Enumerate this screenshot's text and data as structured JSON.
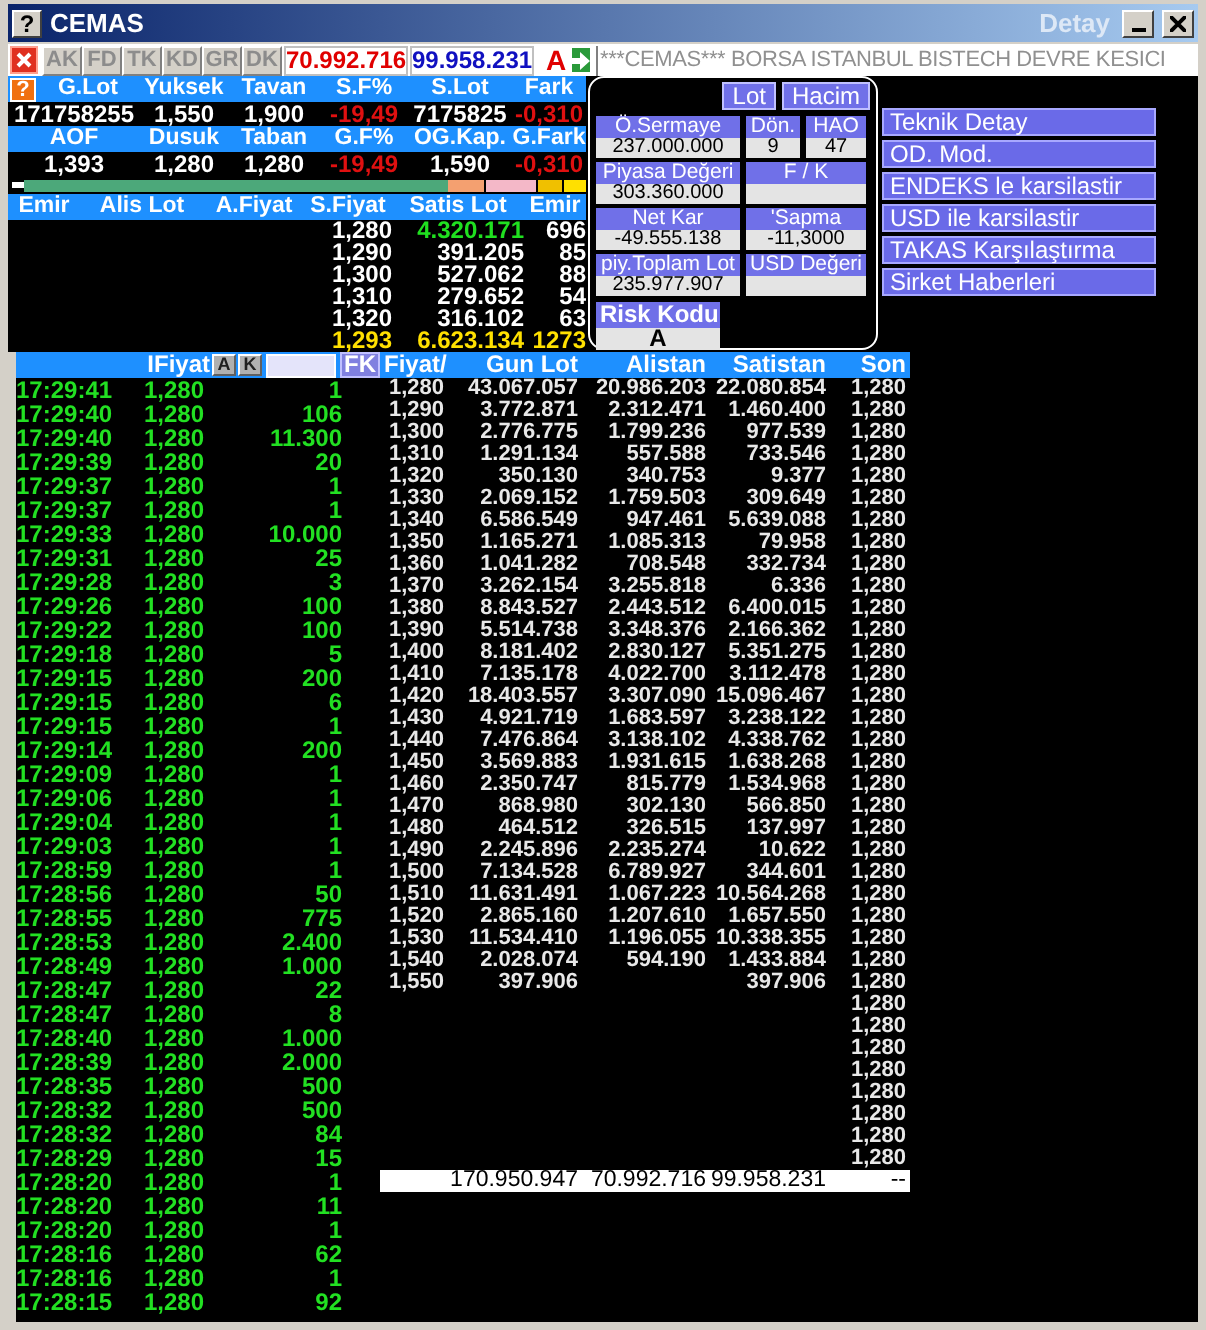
{
  "window": {
    "help_glyph": "?",
    "title": "CEMAS",
    "subtitle": "Detay"
  },
  "toolbar": {
    "buttons": [
      "AK",
      "FD",
      "TK",
      "KD",
      "GR",
      "DK"
    ],
    "values": [
      {
        "text": "70.992.716",
        "color": "#e00000"
      },
      {
        "text": "99.958.231",
        "color": "#1010c0"
      }
    ],
    "flag": "A",
    "ticker": "***CEMAS*** BORSA ISTANBUL BISTECH DEVRE KESICI"
  },
  "quote": {
    "rows": [
      {
        "help": "?",
        "headers": [
          "G.Lot",
          "Yuksek",
          "Tavan",
          "S.F%",
          "S.Lot",
          "Fark"
        ],
        "values": [
          {
            "text": "171758255",
            "negative": false
          },
          {
            "text": "1,550",
            "negative": false
          },
          {
            "text": "1,900",
            "negative": false
          },
          {
            "text": "-19,49",
            "negative": true
          },
          {
            "text": "7175825",
            "negative": false
          },
          {
            "text": "-0,310",
            "negative": true
          }
        ]
      },
      {
        "headers": [
          "AOF",
          "Dusuk",
          "Taban",
          "G.F%",
          "OG.Kap.",
          "G.Fark"
        ],
        "values": [
          {
            "text": "1,393",
            "negative": false
          },
          {
            "text": "1,280",
            "negative": false
          },
          {
            "text": "1,280",
            "negative": false
          },
          {
            "text": "-19,49",
            "negative": true
          },
          {
            "text": "1,590",
            "negative": false
          },
          {
            "text": "-0,310",
            "negative": true
          }
        ]
      }
    ]
  },
  "order_book": {
    "columns": [
      "Emir",
      "Alis Lot",
      "A.Fiyat",
      "S.Fiyat",
      "Satis Lot",
      "Emir"
    ],
    "rows": [
      {
        "s_fiyat": "1,280",
        "satis_lot": "4.320.171",
        "emir": "696",
        "highlight": true
      },
      {
        "s_fiyat": "1,290",
        "satis_lot": "391.205",
        "emir": "85",
        "highlight": false
      },
      {
        "s_fiyat": "1,300",
        "satis_lot": "527.062",
        "emir": "88",
        "highlight": false
      },
      {
        "s_fiyat": "1,310",
        "satis_lot": "279.652",
        "emir": "54",
        "highlight": false
      },
      {
        "s_fiyat": "1,320",
        "satis_lot": "316.102",
        "emir": "63",
        "highlight": false
      }
    ],
    "total": {
      "s_fiyat": "1,293",
      "satis_lot": "6.623.134",
      "emir": "1273"
    }
  },
  "info_panel": {
    "toggles": [
      "Lot",
      "Hacim"
    ],
    "rows": [
      {
        "fields": [
          {
            "label": "Ö.Sermaye",
            "value": "237.000.000"
          },
          {
            "label": "Dön.",
            "value": "9"
          },
          {
            "label": "HAO",
            "value": "47"
          }
        ]
      },
      {
        "fields": [
          {
            "label": "Piyasa Değeri",
            "value": "303.360.000"
          },
          {
            "label": "F / K"
          }
        ]
      },
      {
        "fields": [
          {
            "label": "Net Kar",
            "value": "-49.555.138"
          },
          {
            "label": "'Sapma",
            "value": "-11,3000"
          }
        ]
      },
      {
        "fields": [
          {
            "label": "piy.Toplam Lot",
            "value": "235.977.907"
          },
          {
            "label": "USD Değeri"
          }
        ]
      }
    ],
    "risk": {
      "label": "Risk Kodu",
      "value": "A"
    }
  },
  "menu": [
    "Teknik Detay",
    "OD. Mod.",
    "ENDEKS le karsilastir",
    "USD ile karsilastir",
    "TAKAS Karşılaştırma",
    "Sirket Haberleri"
  ],
  "trades": {
    "header": {
      "label": "IFiyat",
      "buttons": [
        "A",
        "K"
      ],
      "filter_button": "FK"
    },
    "rows": [
      [
        "17:29:41",
        "1,280",
        "1"
      ],
      [
        "17:29:40",
        "1,280",
        "106"
      ],
      [
        "17:29:40",
        "1,280",
        "11.300"
      ],
      [
        "17:29:39",
        "1,280",
        "20"
      ],
      [
        "17:29:37",
        "1,280",
        "1"
      ],
      [
        "17:29:37",
        "1,280",
        "1"
      ],
      [
        "17:29:33",
        "1,280",
        "10.000"
      ],
      [
        "17:29:31",
        "1,280",
        "25"
      ],
      [
        "17:29:28",
        "1,280",
        "3"
      ],
      [
        "17:29:26",
        "1,280",
        "100"
      ],
      [
        "17:29:22",
        "1,280",
        "100"
      ],
      [
        "17:29:18",
        "1,280",
        "5"
      ],
      [
        "17:29:15",
        "1,280",
        "200"
      ],
      [
        "17:29:15",
        "1,280",
        "6"
      ],
      [
        "17:29:15",
        "1,280",
        "1"
      ],
      [
        "17:29:14",
        "1,280",
        "200"
      ],
      [
        "17:29:09",
        "1,280",
        "1"
      ],
      [
        "17:29:06",
        "1,280",
        "1"
      ],
      [
        "17:29:04",
        "1,280",
        "1"
      ],
      [
        "17:29:03",
        "1,280",
        "1"
      ],
      [
        "17:28:59",
        "1,280",
        "1"
      ],
      [
        "17:28:56",
        "1,280",
        "50"
      ],
      [
        "17:28:55",
        "1,280",
        "775"
      ],
      [
        "17:28:53",
        "1,280",
        "2.400"
      ],
      [
        "17:28:49",
        "1,280",
        "1.000"
      ],
      [
        "17:28:47",
        "1,280",
        "22"
      ],
      [
        "17:28:47",
        "1,280",
        "8"
      ],
      [
        "17:28:40",
        "1,280",
        "1.000"
      ],
      [
        "17:28:39",
        "1,280",
        "2.000"
      ],
      [
        "17:28:35",
        "1,280",
        "500"
      ],
      [
        "17:28:32",
        "1,280",
        "500"
      ],
      [
        "17:28:32",
        "1,280",
        "84"
      ],
      [
        "17:28:29",
        "1,280",
        "15"
      ],
      [
        "17:28:20",
        "1,280",
        "1"
      ],
      [
        "17:28:20",
        "1,280",
        "11"
      ],
      [
        "17:28:20",
        "1,280",
        "1"
      ],
      [
        "17:28:16",
        "1,280",
        "62"
      ],
      [
        "17:28:16",
        "1,280",
        "1"
      ],
      [
        "17:28:15",
        "1,280",
        "92"
      ]
    ]
  },
  "price_table": {
    "columns": [
      "Fiyat/",
      "Gun Lot",
      "Alistan",
      "Satistan",
      "Son"
    ],
    "rows": [
      {
        "fiyat": "1,280",
        "gun_lot": "43.067.057",
        "alistan": "20.986.203",
        "satistan": "22.080.854",
        "son": "1,280"
      },
      {
        "fiyat": "1,290",
        "gun_lot": "3.772.871",
        "alistan": "2.312.471",
        "satistan": "1.460.400",
        "son": "1,280"
      },
      {
        "fiyat": "1,300",
        "gun_lot": "2.776.775",
        "alistan": "1.799.236",
        "satistan": "977.539",
        "son": "1,280"
      },
      {
        "fiyat": "1,310",
        "gun_lot": "1.291.134",
        "alistan": "557.588",
        "satistan": "733.546",
        "son": "1,280"
      },
      {
        "fiyat": "1,320",
        "gun_lot": "350.130",
        "alistan": "340.753",
        "satistan": "9.377",
        "son": "1,280"
      },
      {
        "fiyat": "1,330",
        "gun_lot": "2.069.152",
        "alistan": "1.759.503",
        "satistan": "309.649",
        "son": "1,280"
      },
      {
        "fiyat": "1,340",
        "gun_lot": "6.586.549",
        "alistan": "947.461",
        "satistan": "5.639.088",
        "son": "1,280"
      },
      {
        "fiyat": "1,350",
        "gun_lot": "1.165.271",
        "alistan": "1.085.313",
        "satistan": "79.958",
        "son": "1,280"
      },
      {
        "fiyat": "1,360",
        "gun_lot": "1.041.282",
        "alistan": "708.548",
        "satistan": "332.734",
        "son": "1,280"
      },
      {
        "fiyat": "1,370",
        "gun_lot": "3.262.154",
        "alistan": "3.255.818",
        "satistan": "6.336",
        "son": "1,280"
      },
      {
        "fiyat": "1,380",
        "gun_lot": "8.843.527",
        "alistan": "2.443.512",
        "satistan": "6.400.015",
        "son": "1,280"
      },
      {
        "fiyat": "1,390",
        "gun_lot": "5.514.738",
        "alistan": "3.348.376",
        "satistan": "2.166.362",
        "son": "1,280"
      },
      {
        "fiyat": "1,400",
        "gun_lot": "8.181.402",
        "alistan": "2.830.127",
        "satistan": "5.351.275",
        "son": "1,280"
      },
      {
        "fiyat": "1,410",
        "gun_lot": "7.135.178",
        "alistan": "4.022.700",
        "satistan": "3.112.478",
        "son": "1,280"
      },
      {
        "fiyat": "1,420",
        "gun_lot": "18.403.557",
        "alistan": "3.307.090",
        "satistan": "15.096.467",
        "son": "1,280"
      },
      {
        "fiyat": "1,430",
        "gun_lot": "4.921.719",
        "alistan": "1.683.597",
        "satistan": "3.238.122",
        "son": "1,280"
      },
      {
        "fiyat": "1,440",
        "gun_lot": "7.476.864",
        "alistan": "3.138.102",
        "satistan": "4.338.762",
        "son": "1,280"
      },
      {
        "fiyat": "1,450",
        "gun_lot": "3.569.883",
        "alistan": "1.931.615",
        "satistan": "1.638.268",
        "son": "1,280"
      },
      {
        "fiyat": "1,460",
        "gun_lot": "2.350.747",
        "alistan": "815.779",
        "satistan": "1.534.968",
        "son": "1,280"
      },
      {
        "fiyat": "1,470",
        "gun_lot": "868.980",
        "alistan": "302.130",
        "satistan": "566.850",
        "son": "1,280"
      },
      {
        "fiyat": "1,480",
        "gun_lot": "464.512",
        "alistan": "326.515",
        "satistan": "137.997",
        "son": "1,280"
      },
      {
        "fiyat": "1,490",
        "gun_lot": "2.245.896",
        "alistan": "2.235.274",
        "satistan": "10.622",
        "son": "1,280"
      },
      {
        "fiyat": "1,500",
        "gun_lot": "7.134.528",
        "alistan": "6.789.927",
        "satistan": "344.601",
        "son": "1,280"
      },
      {
        "fiyat": "1,510",
        "gun_lot": "11.631.491",
        "alistan": "1.067.223",
        "satistan": "10.564.268",
        "son": "1,280"
      },
      {
        "fiyat": "1,520",
        "gun_lot": "2.865.160",
        "alistan": "1.207.610",
        "satistan": "1.657.550",
        "son": "1,280"
      },
      {
        "fiyat": "1,530",
        "gun_lot": "11.534.410",
        "alistan": "1.196.055",
        "satistan": "10.338.355",
        "son": "1,280"
      },
      {
        "fiyat": "1,540",
        "gun_lot": "2.028.074",
        "alistan": "594.190",
        "satistan": "1.433.884",
        "son": "1,280"
      },
      {
        "fiyat": "1,550",
        "gun_lot": "397.906",
        "satistan": "397.906",
        "son": "1,280"
      },
      {
        "son": "1,280"
      },
      {
        "son": "1,280"
      },
      {
        "son": "1,280"
      },
      {
        "son": "1,280"
      },
      {
        "son": "1,280"
      },
      {
        "son": "1,280"
      },
      {
        "son": "1,280"
      },
      {
        "son": "1,280"
      }
    ],
    "totals": {
      "gun_lot": "170.950.947",
      "alistan": "70.992.716",
      "satistan": "99.958.231",
      "son": "--"
    }
  }
}
